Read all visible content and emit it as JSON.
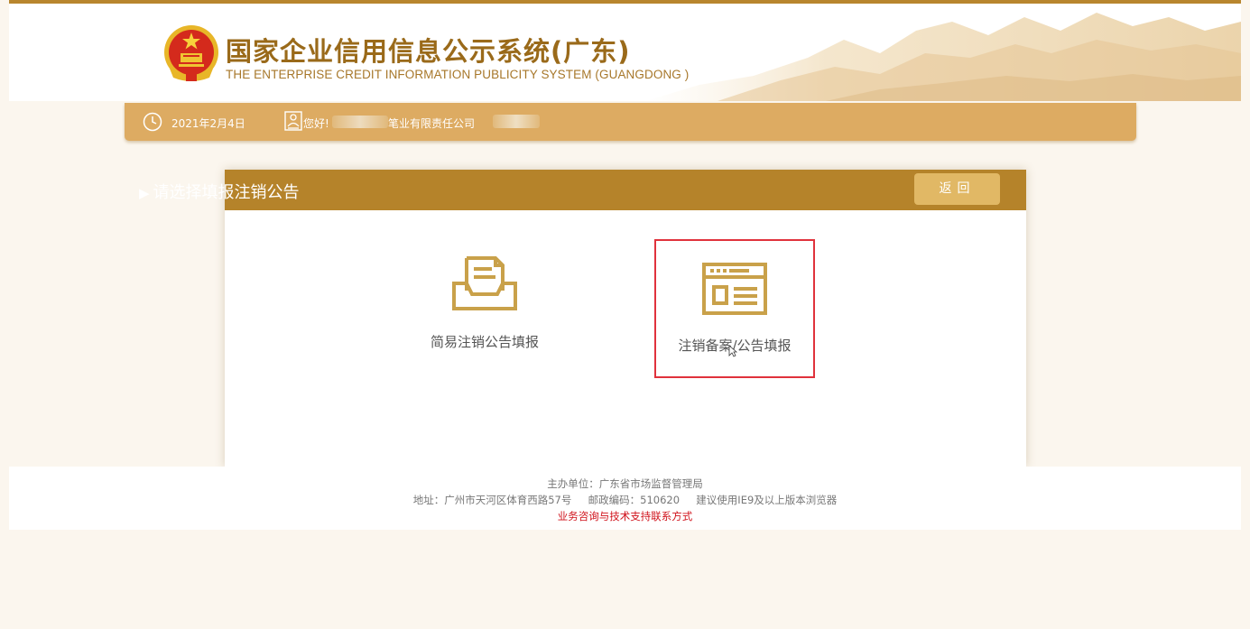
{
  "header": {
    "title": "国家企业信用信息公示系统(广东)",
    "subtitle": "THE ENTERPRISE CREDIT INFORMATION PUBLICITY SYSTEM (GUANGDONG )"
  },
  "infobar": {
    "date": "2021年2月4日",
    "greeting": "您好!",
    "company_suffix": "笔业有限责任公司"
  },
  "panel": {
    "title": "请选择填报注销公告",
    "back_label": "返回",
    "options": [
      {
        "label": "简易注销公告填报",
        "icon": "inbox-tray-icon"
      },
      {
        "label": "注销备案/公告填报",
        "icon": "notice-board-icon"
      }
    ]
  },
  "footer": {
    "sponsor": "主办单位：广东省市场监督管理局",
    "address": "地址：广州市天河区体育西路57号     邮政编码：510620     建议使用IE9及以上版本浏览器",
    "contact": "业务咨询与技术支持联系方式"
  },
  "colors": {
    "brand_gold": "#b5832a",
    "infobar": "#ddab62",
    "button": "#e1b865",
    "highlight_border": "#e0323c",
    "contact_link": "#d0121b"
  }
}
